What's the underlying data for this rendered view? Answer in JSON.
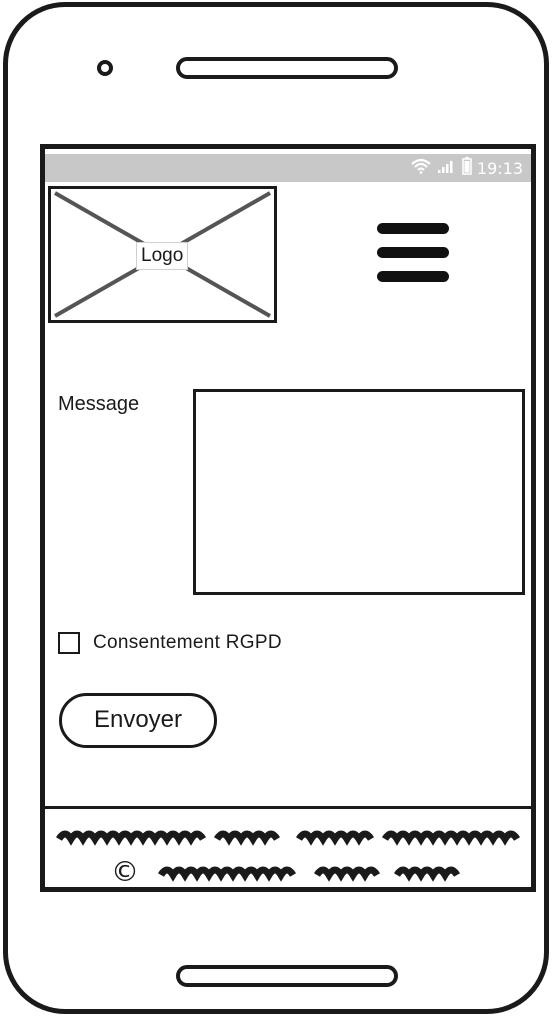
{
  "status_bar": {
    "time": "19:13",
    "icons": [
      "wifi-icon",
      "signal-icon",
      "battery-icon"
    ]
  },
  "header": {
    "logo_label": "Logo",
    "menu_icon": "hamburger-menu-icon"
  },
  "form": {
    "message_label": "Message",
    "message_value": "",
    "consent_label": "Consentement RGPD",
    "consent_checked": false,
    "submit_label": "Envoyer"
  },
  "footer": {
    "copyright_symbol": "©"
  },
  "colors": {
    "ink": "#1a1a1a",
    "status_bar": "#c8c8c8",
    "placeholder_cross": "#555555"
  }
}
